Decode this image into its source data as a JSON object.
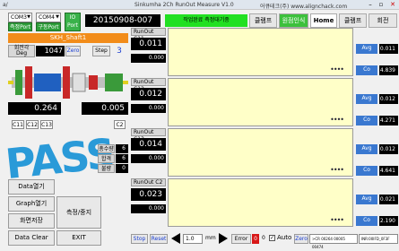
{
  "titlebar": {
    "app_title": "Sinkumha  2Ch RunOut Measure V1.0",
    "company": "어큐테크(주) www.alignchack.com"
  },
  "ports": {
    "port1": "COM3",
    "port2": "COM4",
    "port1_btn": "측정Port",
    "port2_btn": "구동Port",
    "io_btn": "IO\nPort"
  },
  "header": {
    "date_code": "20150908-007",
    "status": "작업완료 측정대기중",
    "tabs": [
      "클램프",
      "원점인식",
      "Home",
      "클램프",
      "회전"
    ]
  },
  "part": {
    "name": "SKH_Shaft1",
    "angle_label": "회전각",
    "angle_label2": "Deg",
    "angle_value": "1047",
    "zero_btn": "Zero",
    "step_label": "Step",
    "step_value": "3",
    "left_val": "0.264",
    "right_val": "0.005",
    "ch_tabs": [
      "C11",
      "C12",
      "C13"
    ],
    "ch_right": "C2"
  },
  "result": {
    "pass_text": "PASS",
    "counts": [
      {
        "label": "총수량",
        "value": "6"
      },
      {
        "label": "합격",
        "value": "6"
      },
      {
        "label": "불량",
        "value": "0"
      }
    ]
  },
  "channels": [
    {
      "name": "RunOut C11",
      "value": "0.011",
      "small": "0.000",
      "avg": "0.011",
      "co": "4.839"
    },
    {
      "name": "RunOut C12",
      "value": "0.012",
      "small": "0.000",
      "avg": "0.012",
      "co": "4.271"
    },
    {
      "name": "RunOut C13",
      "value": "0.014",
      "small": "0.000",
      "avg": "0.012",
      "co": "4.641"
    },
    {
      "name": "RunOut C2",
      "value": "0.023",
      "small": "0.000",
      "avg": "0.021",
      "co": "2.190"
    }
  ],
  "side_labels": {
    "avg": "Avg",
    "co": "Co"
  },
  "left_buttons": {
    "data_open": "Data열기",
    "graph_open": "Graph열기",
    "screen_save": "화면저장",
    "measure": "측정/중지",
    "data_clear": "Data Clear",
    "exit": "EXIT"
  },
  "bottom": {
    "stop": "Stop",
    "reset": "Reset",
    "mm_value": "1.0",
    "mm_unit": "mm",
    "error": "Error",
    "err_count": "0",
    "err_val": "0",
    "auto": "Auto",
    "zero": "Zero",
    "log1": ">CR 00264 00005 00474",
    "log2": "INR:00IFD_0F3F"
  }
}
